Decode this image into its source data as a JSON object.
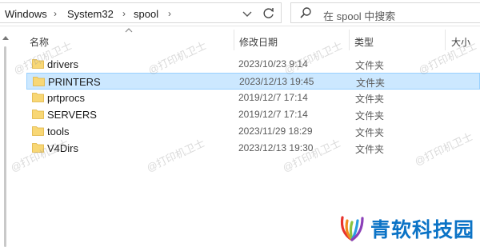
{
  "address": {
    "crumbs": [
      "Windows",
      "System32",
      "spool"
    ],
    "refresh_icon": "refresh-icon",
    "chevron_icon": "chevron-down-icon"
  },
  "search": {
    "placeholder": "在 spool 中搜索",
    "icon": "search-icon"
  },
  "columns": {
    "name": "名称",
    "modified": "修改日期",
    "type": "类型",
    "size": "大小"
  },
  "files": [
    {
      "name": "drivers",
      "modified": "2023/10/23 9:14",
      "type": "文件夹"
    },
    {
      "name": "PRINTERS",
      "modified": "2023/12/13 19:45",
      "type": "文件夹"
    },
    {
      "name": "prtprocs",
      "modified": "2019/12/7 17:14",
      "type": "文件夹"
    },
    {
      "name": "SERVERS",
      "modified": "2019/12/7 17:14",
      "type": "文件夹"
    },
    {
      "name": "tools",
      "modified": "2023/11/29 18:29",
      "type": "文件夹"
    },
    {
      "name": "V4Dirs",
      "modified": "2023/12/13 19:30",
      "type": "文件夹"
    }
  ],
  "selected_index": 1,
  "colors": {
    "selection_bg": "#cce8ff",
    "selection_border": "#99d1ff",
    "folder_yellow": "#f8d775",
    "logo_blue": "#0b73c6"
  },
  "watermark": "@打印机卫士",
  "logo": {
    "text": "青软科技园"
  }
}
